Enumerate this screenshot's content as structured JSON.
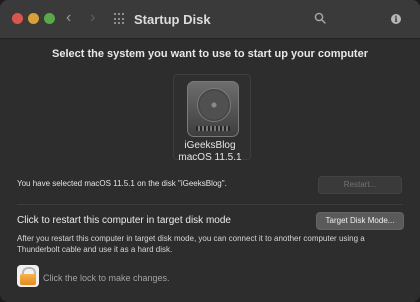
{
  "window": {
    "title": "Startup Disk"
  },
  "toolbar": {
    "back_icon": "chevron-left-icon",
    "forward_icon": "chevron-right-icon",
    "grid_icon": "grid-icon",
    "search_icon": "search-icon",
    "info_icon": "info-icon",
    "info_glyph": "i"
  },
  "main": {
    "heading": "Select the system you want to use to start up your computer",
    "disk": {
      "name": "iGeeksBlog",
      "os": "macOS 11.5.1"
    },
    "selected_text": "You have selected macOS 11.5.1 on the disk \"iGeeksBlog\".",
    "restart_label": "Restart..."
  },
  "target_disk": {
    "label": "Click to restart this computer in target disk mode",
    "button_label": "Target Disk Mode...",
    "description": "After you restart this computer in target disk mode, you can connect it to another computer using a Thunderbolt cable and use it as a hard disk."
  },
  "footer": {
    "lock_text": "Click the lock to make changes."
  },
  "colors": {
    "accent": "#f7b24e",
    "background": "#2d2d2d"
  }
}
